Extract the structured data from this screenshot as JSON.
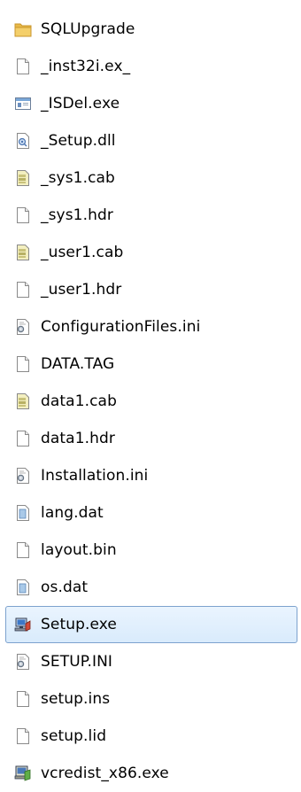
{
  "explorer": {
    "files": [
      {
        "name": "SQLUpgrade",
        "icon": "folder-icon"
      },
      {
        "name": "_inst32i.ex_",
        "icon": "blank-file-icon"
      },
      {
        "name": "_ISDel.exe",
        "icon": "window-exe-icon"
      },
      {
        "name": "_Setup.dll",
        "icon": "dll-icon"
      },
      {
        "name": "_sys1.cab",
        "icon": "cab-archive-icon"
      },
      {
        "name": "_sys1.hdr",
        "icon": "blank-file-icon"
      },
      {
        "name": "_user1.cab",
        "icon": "cab-archive-icon"
      },
      {
        "name": "_user1.hdr",
        "icon": "blank-file-icon"
      },
      {
        "name": "ConfigurationFiles.ini",
        "icon": "ini-settings-icon"
      },
      {
        "name": "DATA.TAG",
        "icon": "blank-file-icon"
      },
      {
        "name": "data1.cab",
        "icon": "cab-archive-icon"
      },
      {
        "name": "data1.hdr",
        "icon": "blank-file-icon"
      },
      {
        "name": "Installation.ini",
        "icon": "ini-settings-icon"
      },
      {
        "name": "lang.dat",
        "icon": "data-file-icon"
      },
      {
        "name": "layout.bin",
        "icon": "blank-file-icon"
      },
      {
        "name": "os.dat",
        "icon": "data-file-icon"
      },
      {
        "name": "Setup.exe",
        "icon": "installer-exe-icon",
        "selected": true
      },
      {
        "name": "SETUP.INI",
        "icon": "ini-settings-icon"
      },
      {
        "name": "setup.ins",
        "icon": "blank-file-icon"
      },
      {
        "name": "setup.lid",
        "icon": "blank-file-icon"
      },
      {
        "name": "vcredist_x86.exe",
        "icon": "vcredist-installer-icon"
      }
    ],
    "colors": {
      "selection_fill": "#d9ebfc",
      "selection_border": "#7da2ce",
      "folder": "#e8b948"
    }
  }
}
